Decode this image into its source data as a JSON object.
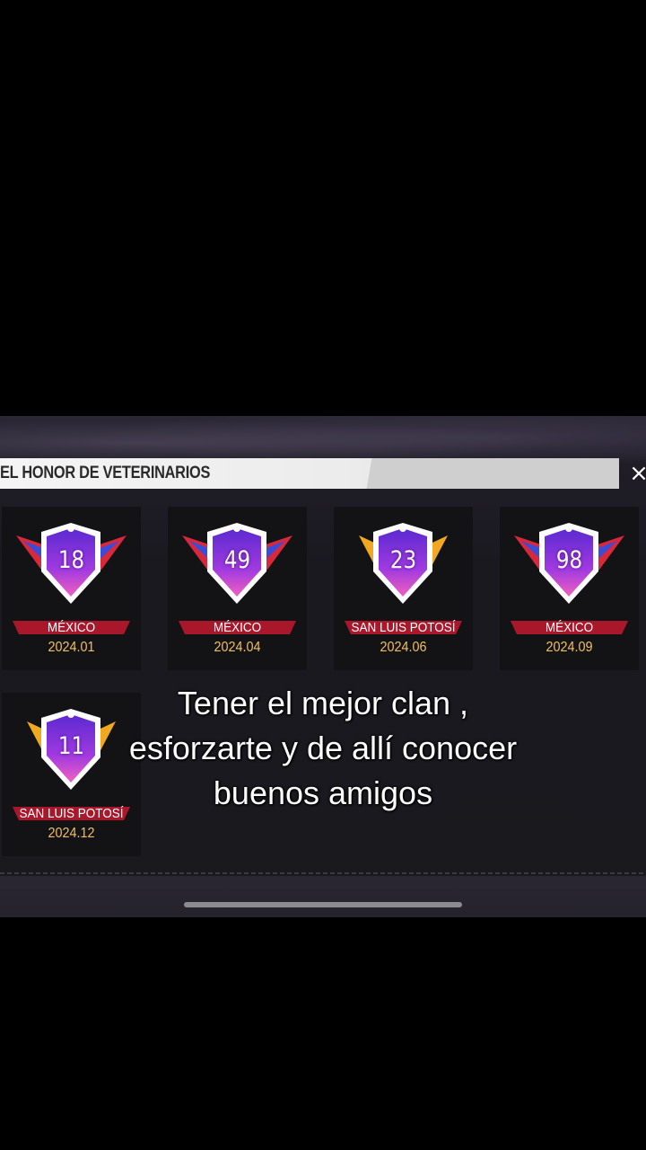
{
  "panel": {
    "title": "EL HONOR DE VETERINARIOS",
    "close_label": "×"
  },
  "cards": [
    {
      "number": "18",
      "region": "MÉXICO",
      "date": "2024.01",
      "tier": "purple-red"
    },
    {
      "number": "49",
      "region": "MÉXICO",
      "date": "2024.04",
      "tier": "purple-red"
    },
    {
      "number": "23",
      "region": "SAN LUIS POTOSÍ",
      "date": "2024.06",
      "tier": "purple-gold"
    },
    {
      "number": "98",
      "region": "MÉXICO",
      "date": "2024.09",
      "tier": "purple-red"
    },
    {
      "number": "11",
      "region": "SAN LUIS POTOSÍ",
      "date": "2024.12",
      "tier": "purple-gold"
    }
  ],
  "caption": {
    "line1": "Tener el mejor clan ,",
    "line2": "esforzarte y de allí conocer",
    "line3": "buenos amigos"
  },
  "colors": {
    "wing_red": "#d8283c",
    "wing_gold": "#f0a820",
    "shield_purple": "#8a3ad8",
    "date_gold": "#f0c060"
  }
}
